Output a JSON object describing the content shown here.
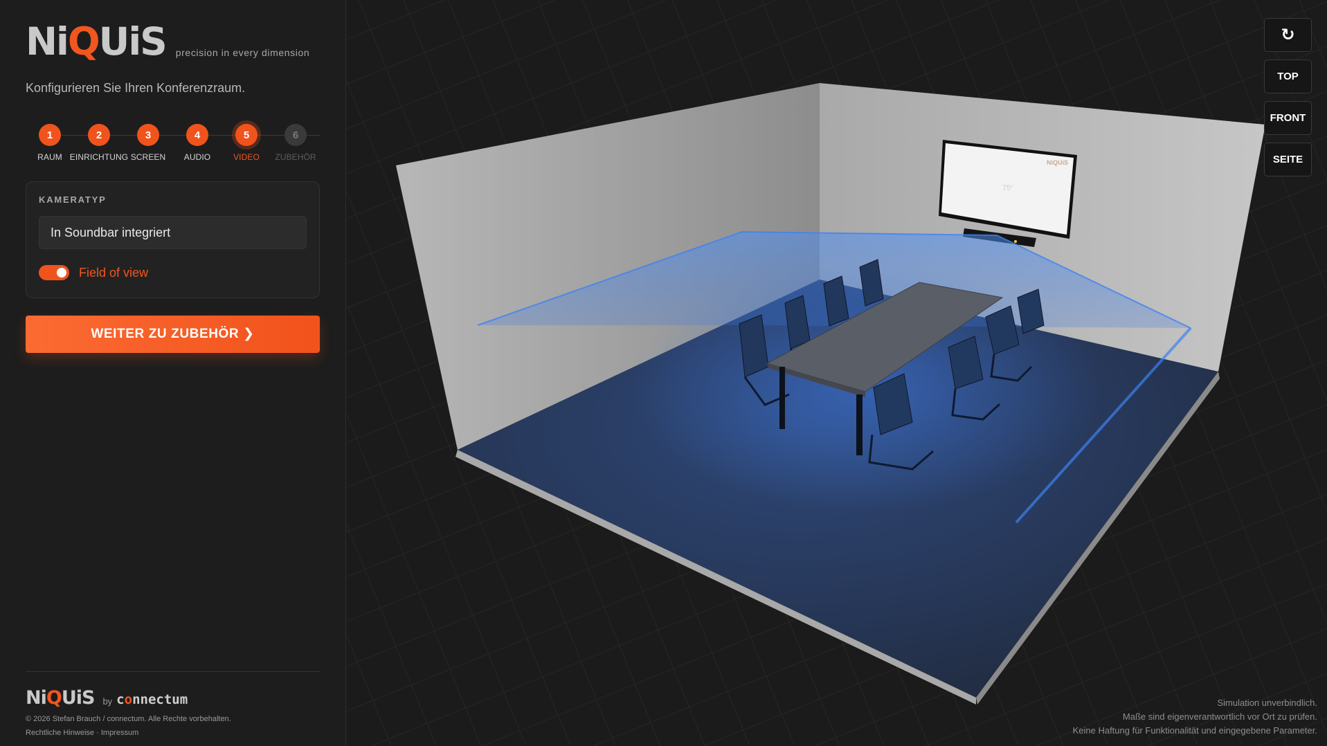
{
  "brand": {
    "pre": "Ni",
    "q": "Q",
    "post": "UiS",
    "tagline": "precision in every dimension"
  },
  "intro": "Konfigurieren Sie Ihren Konferenzraum.",
  "steps": [
    {
      "num": "1",
      "label": "RAUM",
      "state": "done"
    },
    {
      "num": "2",
      "label": "EINRICHTUNG",
      "state": "done"
    },
    {
      "num": "3",
      "label": "SCREEN",
      "state": "done"
    },
    {
      "num": "4",
      "label": "AUDIO",
      "state": "done"
    },
    {
      "num": "5",
      "label": "VIDEO",
      "state": "current"
    },
    {
      "num": "6",
      "label": "ZUBEHÖR",
      "state": "disabled"
    }
  ],
  "camera": {
    "heading": "KAMERATYP",
    "selected": "In Soundbar integriert",
    "fov_label": "Field of view",
    "fov_enabled": true
  },
  "cta_label": "WEITER ZU ZUBEHÖR ❯",
  "footer": {
    "brand_pre": "Ni",
    "brand_q": "Q",
    "brand_post": "UiS",
    "by": "by",
    "partner_pre": "c",
    "partner_o": "o",
    "partner_post": "nnectum",
    "copyright": "© 2026 Stefan Brauch / connectum. Alle Rechte vorbehalten.",
    "legal": "Rechtliche Hinweise",
    "dot": "·",
    "imprint": "Impressum"
  },
  "view_controls": {
    "reset_icon": "↻",
    "top": "TOP",
    "front": "FRONT",
    "side": "SEITE"
  },
  "screen": {
    "size_label": "75\"",
    "logo_text": "NiQUiS"
  },
  "disclaimer": [
    "Simulation unverbindlich.",
    "Maße sind eigenverantwortlich vor Ort zu prüfen.",
    "Keine Haftung für Funktionalität und eingegebene Parameter."
  ],
  "colors": {
    "accent": "#f2561f",
    "sidebar_bg": "#1d1d1d",
    "viewport_bg": "#1b1b1b",
    "fov": "#3d82f0"
  }
}
